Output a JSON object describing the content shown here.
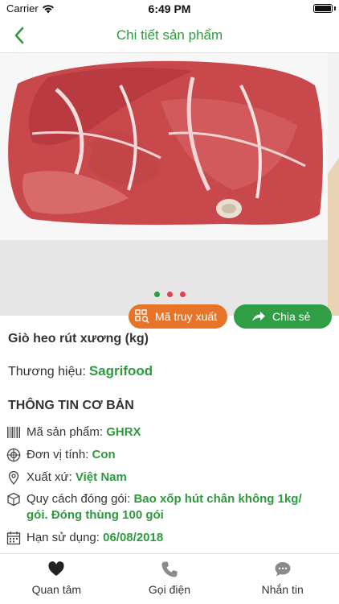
{
  "status_bar": {
    "carrier": "Carrier",
    "time": "6:49 PM"
  },
  "header": {
    "title": "Chi tiết sản phẩm"
  },
  "carousel": {
    "dot_count": 3,
    "active_index": 0,
    "dot_colors": [
      "#2e9a3f",
      "#e0434f",
      "#e0434f"
    ]
  },
  "actions": {
    "trace_label": "Mã truy xuất",
    "share_label": "Chia sẻ"
  },
  "product": {
    "name": "Giò heo rút xương (kg)",
    "brand_label": "Thương hiệu:",
    "brand_value": "Sagrifood"
  },
  "basic_info": {
    "section_title": "THÔNG TIN CƠ BẢN",
    "code_label": "Mã sản phẩm:",
    "code_value": "GHRX",
    "unit_label": "Đơn vị tính:",
    "unit_value": "Con",
    "origin_label": "Xuất xứ:",
    "origin_value": "Việt Nam",
    "packaging_label": "Quy cách đóng gói:",
    "packaging_value_line1": "Bao xốp hút chân không 1kg/",
    "packaging_value_line2": "gói. Đóng thùng 100 gói",
    "expiry_label": "Hạn sử dụng:",
    "expiry_value": "06/08/2018"
  },
  "tabs": [
    {
      "label": "Quan tâm",
      "icon": "heart-icon"
    },
    {
      "label": "Gọi điện",
      "icon": "phone-icon"
    },
    {
      "label": "Nhắn tin",
      "icon": "chat-bubble-icon"
    }
  ],
  "colors": {
    "brand_green": "#2e9a3f",
    "trace_orange": "#e8742a",
    "share_green": "#2f9e45"
  }
}
